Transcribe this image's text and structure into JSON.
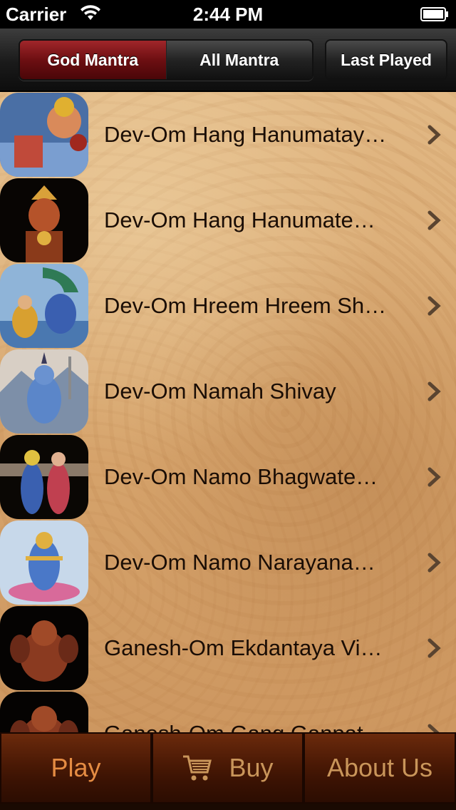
{
  "status_bar": {
    "carrier": "Carrier",
    "time": "2:44 PM",
    "wifi_icon": "wifi-icon",
    "battery_icon": "battery-icon"
  },
  "nav": {
    "segments": [
      {
        "label": "God Mantra",
        "selected": true
      },
      {
        "label": "All Mantra",
        "selected": false
      }
    ],
    "last_played_label": "Last Played"
  },
  "mantras": [
    {
      "title": "Dev-Om Hang Hanumatay…",
      "icon": "hanuman-thumbnail"
    },
    {
      "title": "Dev-Om Hang Hanumate…",
      "icon": "hanuman-dark-thumbnail"
    },
    {
      "title": "Dev-Om Hreem Hreem Sh…",
      "icon": "vishnu-lakshmi-thumbnail"
    },
    {
      "title": "Dev-Om Namah Shivay",
      "icon": "shiva-thumbnail"
    },
    {
      "title": "Dev-Om Namo Bhagwate…",
      "icon": "radha-krishna-thumbnail"
    },
    {
      "title": "Dev-Om Namo Narayana…",
      "icon": "vishnu-thumbnail"
    },
    {
      "title": "Ganesh-Om Ekdantaya Vi…",
      "icon": "ganesh-thumbnail"
    },
    {
      "title": "Ganesh-Om Gang Ganpat…",
      "icon": "ganesh-thumbnail-2"
    }
  ],
  "tab_bar": {
    "play_label": "Play",
    "buy_label": "Buy",
    "buy_icon": "cart-icon",
    "about_label": "About Us"
  },
  "colors": {
    "selected_segment": "#8b1a1d",
    "list_background": "#d9a86f",
    "tab_active_text": "#e58c43",
    "tab_text": "#c9955a"
  }
}
